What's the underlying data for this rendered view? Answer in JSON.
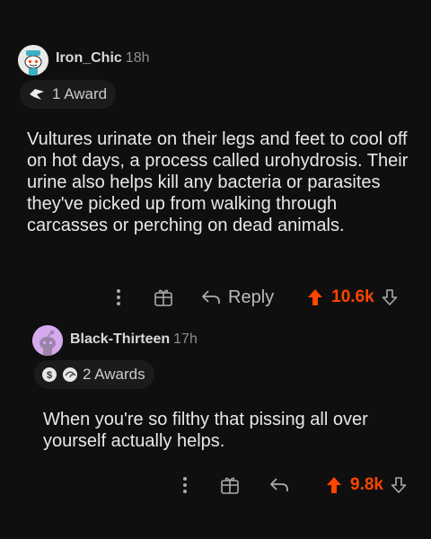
{
  "comments": [
    {
      "username": "Iron_Chic",
      "timestamp": "18h",
      "awards_label": "1 Award",
      "body": "Vultures urinate on their legs and feet to cool off on hot days, a process called urohydrosis. Their urine also helps kill any bacteria or parasites they've picked up from walking through carcasses or perching on dead animals.",
      "reply_label": "Reply",
      "score": "10.6k",
      "avatar_bg": "#e9e9e9",
      "upvote_color": "#ff4500"
    },
    {
      "username": "Black-Thirteen",
      "timestamp": "17h",
      "awards_label": "2 Awards",
      "body": "When you're so filthy that pissing all over yourself actually helps.",
      "score": "9.8k",
      "avatar_bg": "#d6a8ee",
      "upvote_color": "#ff4500"
    }
  ],
  "icons": {
    "more": "more-vertical-icon",
    "award": "award-icon",
    "reply": "reply-arrow-icon",
    "upvote": "upvote-arrow-icon",
    "downvote": "downvote-arrow-icon"
  }
}
